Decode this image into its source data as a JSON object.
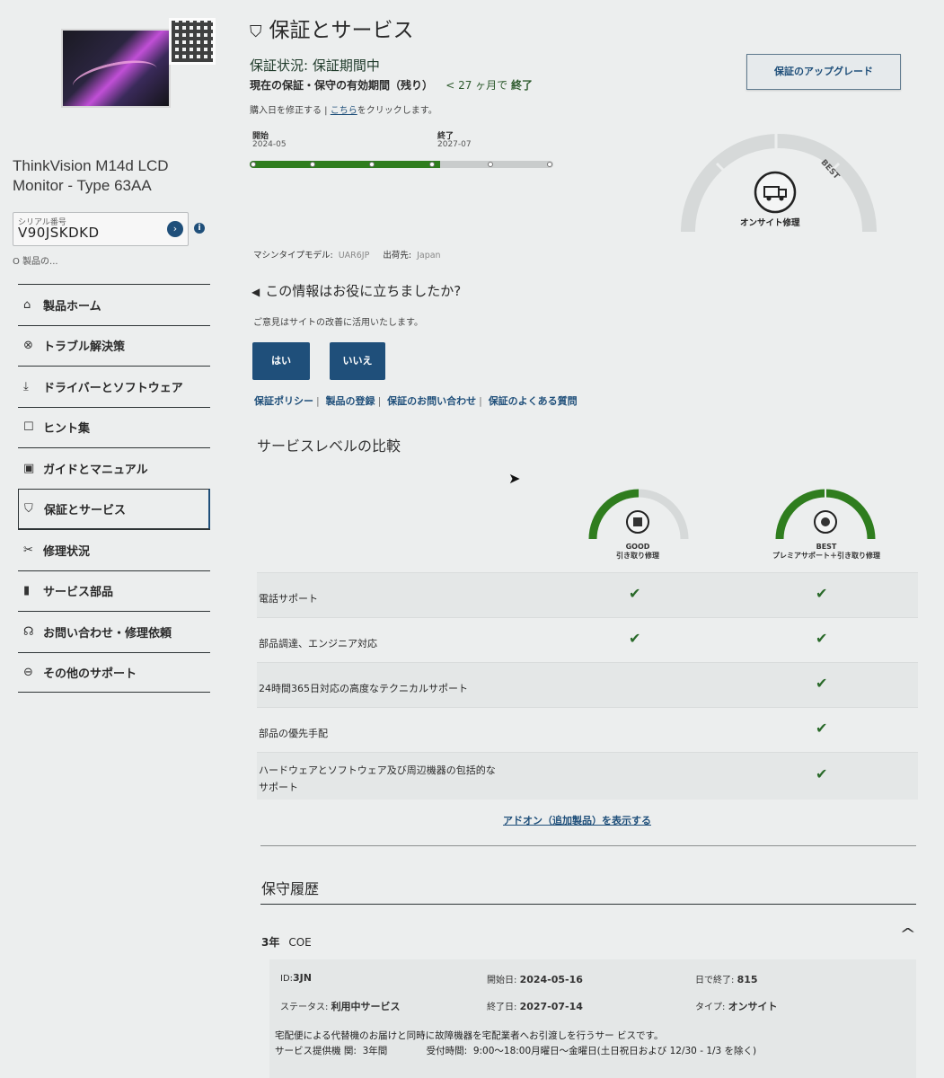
{
  "sidebar": {
    "product_name": "ThinkVision M14d LCD Monitor - Type 63AA",
    "serial_label": "シリアル番号",
    "serial_value": "V90JSKDKD",
    "serial_note": "O 製品の...",
    "nav": [
      {
        "icon": "⌂",
        "label": "製品ホーム"
      },
      {
        "icon": "⊗",
        "label": "トラブル解決策"
      },
      {
        "icon": "⤓",
        "label": "ドライバーとソフトウェア"
      },
      {
        "icon": "☐",
        "label": "ヒント集"
      },
      {
        "icon": "▣",
        "label": "ガイドとマニュアル"
      },
      {
        "icon": "⛉",
        "label": "保証とサービス"
      },
      {
        "icon": "✂",
        "label": "修理状況"
      },
      {
        "icon": "▮",
        "label": "サービス部品"
      },
      {
        "icon": "☊",
        "label": "お問い合わせ・修理依頼"
      },
      {
        "icon": "⊖",
        "label": "その他のサポート"
      }
    ]
  },
  "header": {
    "title": "保証とサービス"
  },
  "warranty": {
    "status": "保証状況: 保証期間中",
    "period_label": "現在の保証・保守の有効期間（残り）",
    "remaining_prefix": "< 27 ヶ月で",
    "remaining_suffix": "終了",
    "modify_prefix": "購入日を修正する | ",
    "modify_link": "こちら",
    "modify_suffix": "をクリックします。",
    "start_label": "開始",
    "start_date": "2024-05",
    "end_label": "終了",
    "end_date": "2027-07",
    "progress": 0.62,
    "upgrade_button": "保証のアップグレード",
    "onsite_label": "オンサイト修理",
    "best_label": "BEST",
    "machine_label": "マシンタイプモデル:",
    "machine_value": "UAR6JP",
    "ship_label": "出荷先:",
    "ship_value": "Japan"
  },
  "feedback": {
    "heading": "この情報はお役に立ちましたか?",
    "sub": "ご意見はサイトの改善に活用いたします。",
    "yes": "はい",
    "no": "いいえ",
    "links": [
      "保証ポリシー",
      "製品の登録",
      "保証のお問い合わせ",
      "保証のよくある質問"
    ]
  },
  "comparison": {
    "heading": "サービスレベルの比較",
    "tiers": [
      {
        "level": "GOOD",
        "name": "引き取り修理"
      },
      {
        "level": "BEST",
        "name": "プレミアサポート＋引き取り修理"
      }
    ],
    "rows": [
      {
        "label": "電話サポート",
        "good": "✔",
        "best": "✔"
      },
      {
        "label": "部品調達、エンジニア対応",
        "good": "✔",
        "best": "✔"
      },
      {
        "label": "24時間365日対応の高度なテクニカルサポート",
        "good": "",
        "best": "✔"
      },
      {
        "label": "部品の優先手配",
        "good": "",
        "best": "✔"
      },
      {
        "label": "ハードウェアとソフトウェア及び周辺機器の包括的な",
        "label2": "サポート",
        "good": "",
        "best": "✔"
      }
    ],
    "addon_link": "アドオン（追加製品）を表示する"
  },
  "history": {
    "heading": "保守履歴",
    "plan": "3年",
    "plan_code": "COE",
    "id_label": "ID:",
    "id_value": "3JN",
    "start_label": "開始日:",
    "start_value": "2024-05-16",
    "days_label": "日で終了:",
    "days_value": "815",
    "status_label": "ステータス:",
    "status_value": "利用中サービス",
    "end_label": "終了日:",
    "end_value": "2027-07-14",
    "type_label": "タイプ:",
    "type_value": "オンサイト",
    "description": "宅配便による代替機のお届けと同時に故障機器を宅配業者へお引渡しを行うサー ビスです。",
    "provider_label": "サービス提供機 関:",
    "provider_value": "3年間",
    "hours_label": "受付時間:",
    "hours_value": "9:00～18:00月曜日～金曜日(土日祝日および 12/30 - 1/3 を除く)"
  },
  "colors": {
    "accent": "#1f4f7a",
    "green": "#2f7d1e",
    "background": "#eceeee"
  }
}
